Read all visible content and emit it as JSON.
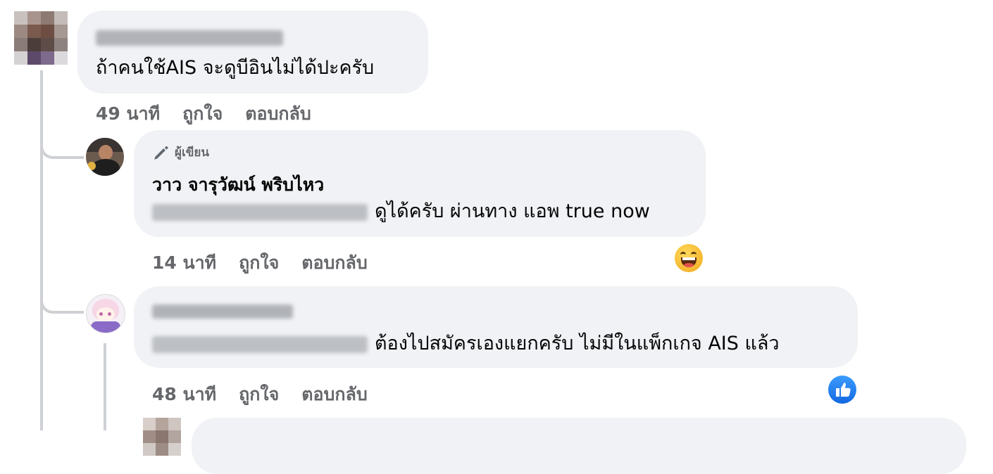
{
  "comments": [
    {
      "text": "ถ้าคนใช้AIS จะดูบีอินไม่ได้ปะครับ",
      "time": "49 นาที",
      "like_label": "ถูกใจ",
      "reply_label": "ตอบกลับ"
    },
    {
      "author_badge": "ผู้เขียน",
      "author": "วาว จารุวัฒน์ พริบไหว",
      "text": "ดูได้ครับ ผ่านทาง แอพ true now",
      "time": "14 นาที",
      "like_label": "ถูกใจ",
      "reply_label": "ตอบกลับ",
      "reaction": "haha-icon"
    },
    {
      "text": "ต้องไปสมัครเองแยกครับ ไม่มีในแพ็กเกจ AIS แล้ว",
      "time": "48 นาที",
      "like_label": "ถูกใจ",
      "reply_label": "ตอบกลับ",
      "reaction": "like-icon"
    }
  ],
  "colors": {
    "bubble": "#f0f2f5",
    "meta_text": "#65676b",
    "thread_line": "#ced0d4",
    "like_blue": "#1877f2",
    "haha_yellow": "#f7b928"
  }
}
